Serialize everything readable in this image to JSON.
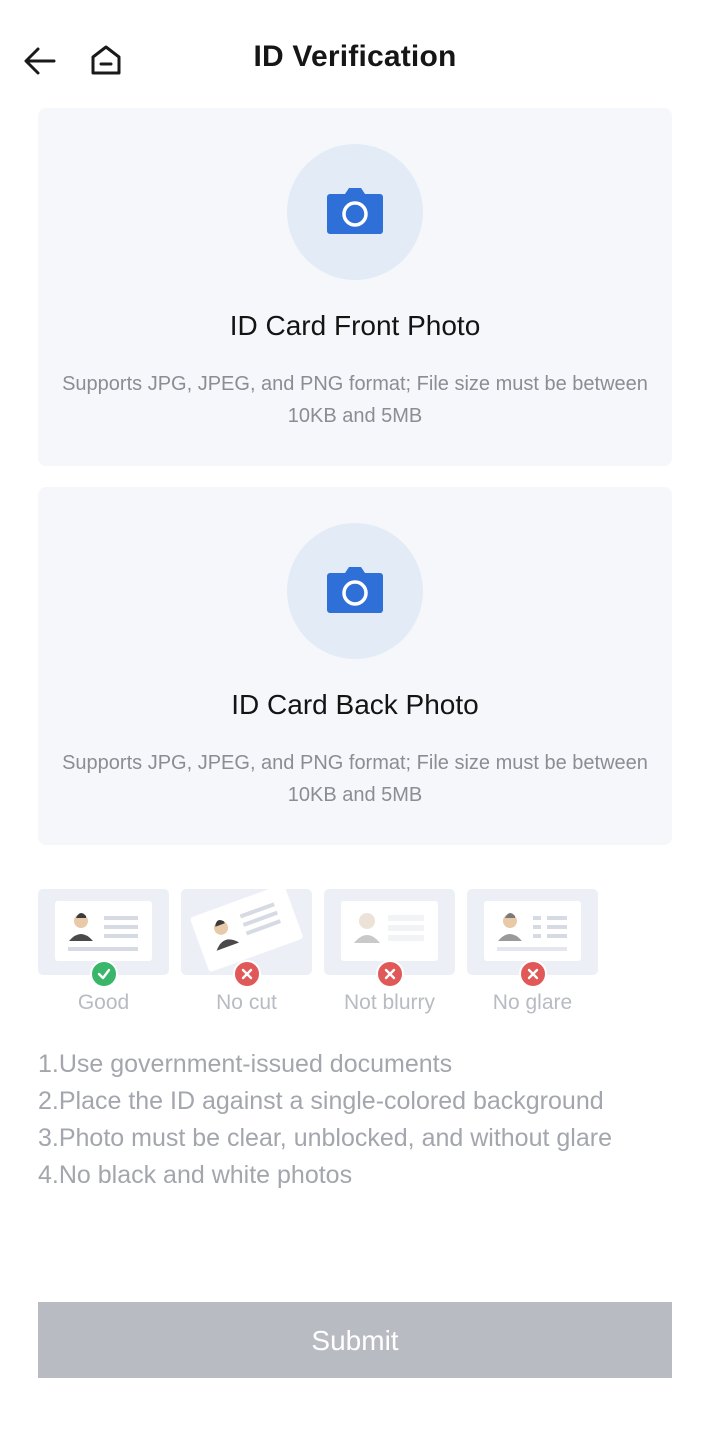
{
  "header": {
    "title": "ID Verification",
    "back_icon": "arrow-left-icon",
    "home_icon": "home-icon"
  },
  "upload_cards": [
    {
      "title": "ID Card Front Photo",
      "description": "Supports JPG, JPEG, and PNG format; File size must be between 10KB and 5MB",
      "icon": "camera-icon"
    },
    {
      "title": "ID Card Back Photo",
      "description": "Supports JPG, JPEG, and PNG format; File size must be between 10KB and 5MB",
      "icon": "camera-icon"
    }
  ],
  "examples": [
    {
      "label": "Good",
      "status": "ok"
    },
    {
      "label": "No cut",
      "status": "bad"
    },
    {
      "label": "Not blurry",
      "status": "bad"
    },
    {
      "label": "No glare",
      "status": "bad"
    }
  ],
  "tips": [
    "1.Use government-issued documents",
    "2.Place the ID against a single-colored background",
    "3.Photo must be clear, unblocked, and without glare",
    "4.No black and white photos"
  ],
  "submit_label": "Submit",
  "colors": {
    "accent": "#2f6fd8",
    "card_bg": "#f6f7fb",
    "icon_circle": "#e3ebf7",
    "ok": "#39b66a",
    "bad": "#e05858",
    "submit_disabled": "#b9bbc2"
  }
}
